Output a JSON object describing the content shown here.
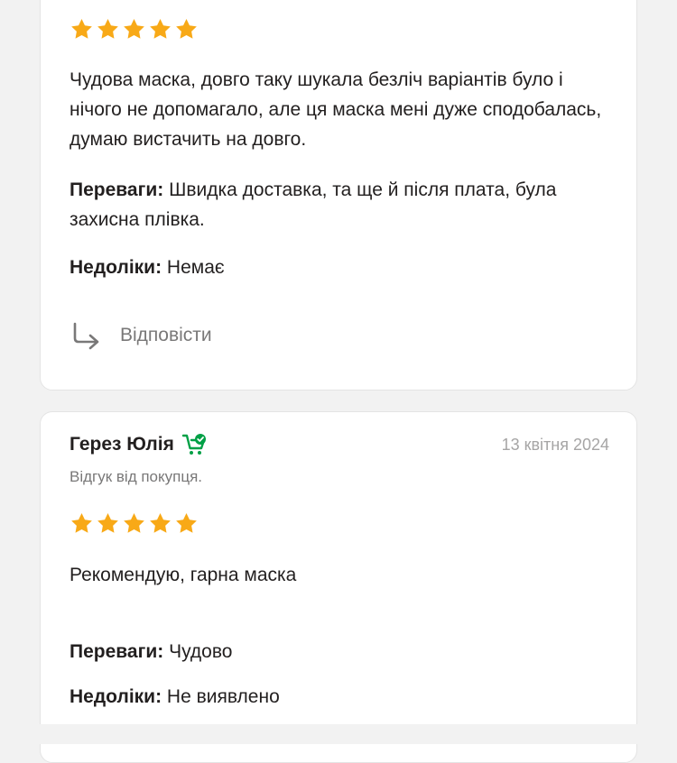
{
  "colors": {
    "star": "#f8a917",
    "buyer_cart": "#00a046",
    "muted_text": "#797878",
    "date_text": "#a6a5a5"
  },
  "reviews": [
    {
      "rating": 5,
      "text": "Чудова маска, довго таку шукала безліч варіантів було і нічого не допомагало, але ця маска мені дуже сподобалась, думаю вистачить на довго.",
      "pros_label": "Переваги:",
      "pros": "Швидка доставка, та ще й після плата, була захисна плівка.",
      "cons_label": "Недоліки:",
      "cons": "Немає",
      "reply_label": "Відповісти",
      "reply_icon": "reply-arrow-icon"
    },
    {
      "author": "Герез Юлія",
      "author_badge_icon": "cart-check-icon",
      "date": "13 квітня 2024",
      "buyer_note": "Відгук від покупця.",
      "rating": 5,
      "text": "Рекомендую, гарна маска",
      "pros_label": "Переваги:",
      "pros": "Чудово",
      "cons_label": "Недоліки:",
      "cons": "Не виявлено"
    }
  ]
}
